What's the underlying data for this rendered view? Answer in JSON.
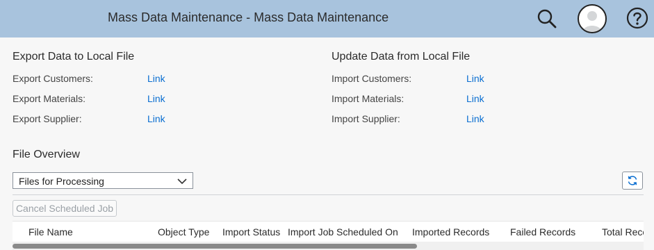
{
  "shell": {
    "title": "Mass Data Maintenance - Mass Data Maintenance",
    "icons": [
      "search-icon",
      "user-avatar-icon",
      "help-icon"
    ],
    "bar_color": "#a8c3dd"
  },
  "export_section": {
    "title": "Export Data to Local File",
    "rows": [
      {
        "label": "Export Customers:",
        "link": "Link"
      },
      {
        "label": "Export Materials:",
        "link": "Link"
      },
      {
        "label": "Export Supplier:",
        "link": "Link"
      }
    ]
  },
  "import_section": {
    "title": "Update Data from Local File",
    "rows": [
      {
        "label": "Import Customers:",
        "link": "Link"
      },
      {
        "label": "Import Materials:",
        "link": "Link"
      },
      {
        "label": "Import Supplier:",
        "link": "Link"
      }
    ]
  },
  "file_overview": {
    "title": "File Overview",
    "filter_selected": "Files for Processing",
    "cancel_button": "Cancel Scheduled Job",
    "columns": [
      "File Name",
      "Object Type",
      "Import Status",
      "Import Job Scheduled On",
      "Imported Records",
      "Failed Records",
      "Total Records"
    ]
  },
  "colors": {
    "link": "#0a6ed1",
    "background": "#f7f7f7"
  }
}
